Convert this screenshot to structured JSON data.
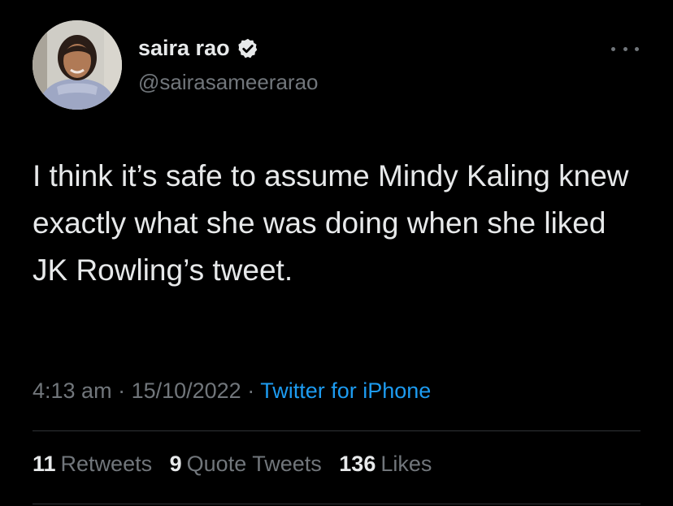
{
  "author": {
    "name": "saira rao",
    "handle": "@sairasameerarao",
    "verified_icon": "verified-badge-icon"
  },
  "tweet": {
    "text": "I think it’s safe to assume Mindy Kaling knew exactly what she was doing when she liked JK Rowling’s tweet."
  },
  "meta": {
    "time": "4:13 am",
    "separator1": " · ",
    "date": "15/10/2022",
    "separator2": " · ",
    "source": "Twitter for iPhone"
  },
  "stats": {
    "retweets_count": "11",
    "retweets_label": "Retweets",
    "quotes_count": "9",
    "quotes_label": "Quote Tweets",
    "likes_count": "136",
    "likes_label": "Likes"
  },
  "colors": {
    "background": "#000000",
    "text": "#e7e9ea",
    "secondary": "#71767b",
    "link": "#1d9bf0"
  }
}
